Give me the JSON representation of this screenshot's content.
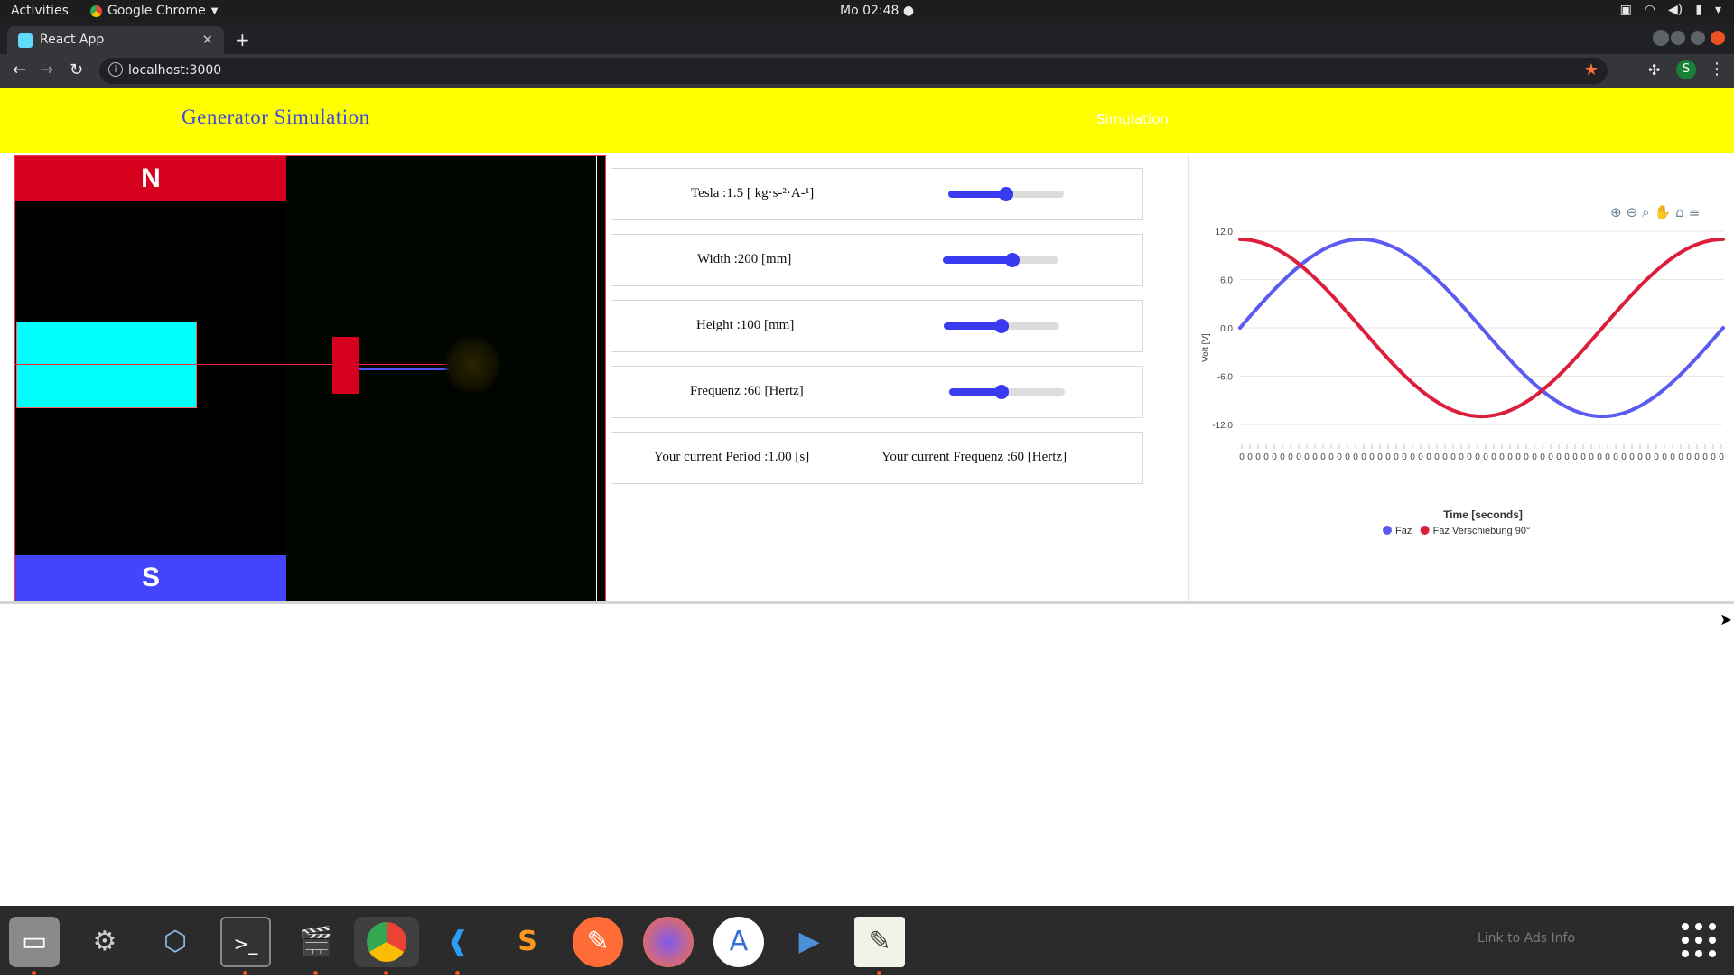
{
  "system": {
    "activities": "Activities",
    "app_menu": "Google Chrome",
    "clock": "Mo 02:48"
  },
  "browser": {
    "tab_title": "React App",
    "url": "localhost:3000",
    "profile_initial": "S"
  },
  "app": {
    "title": "Generator Simulation",
    "nav_simulation": "Simulation"
  },
  "simulation": {
    "north_label": "N",
    "south_label": "S"
  },
  "controls": {
    "tesla_label": "Tesla :1.5 [ kg·s-²·A-¹]",
    "tesla_value": 0.5,
    "width_label": "Width :200 [mm]",
    "width_value": 0.6,
    "height_label": "Height :100 [mm]",
    "height_value": 0.5,
    "frequenz_label": "Frequenz :60 [Hertz]",
    "frequenz_value": 0.45,
    "period_text": "Your current Period :1.00 [s]",
    "frequency_text": "Your current Frequenz :60 [Hertz]"
  },
  "chart_data": {
    "type": "line",
    "xlabel": "Time [seconds]",
    "ylabel": "Volt [V]",
    "ylim": [
      -12,
      12
    ],
    "yticks": [
      "12.0",
      "6.0",
      "0.0",
      "-6.0",
      "-12.0"
    ],
    "x_tick_label": "0",
    "x_tick_count": 60,
    "legend_position": "bottom",
    "series": [
      {
        "name": "Faz",
        "color": "#5b5bf0",
        "amplitude": 11,
        "phase_deg": 0
      },
      {
        "name": "Faz Verschiebung 90°",
        "color": "#dc1e3c",
        "amplitude": 11,
        "phase_deg": 90
      }
    ]
  },
  "dock": {
    "ads_info": "Link to Ads Info"
  }
}
